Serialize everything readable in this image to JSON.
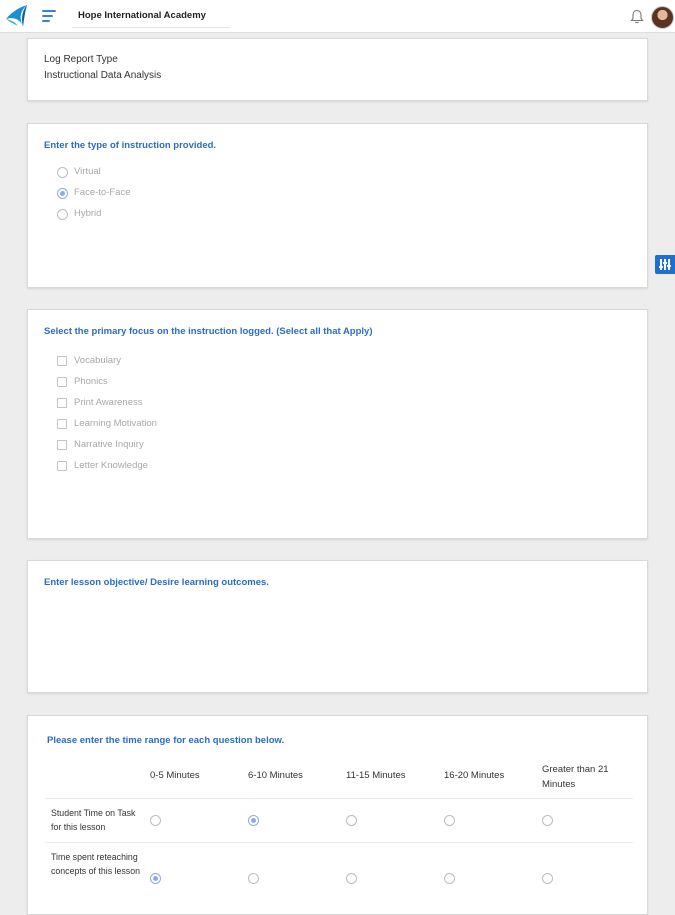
{
  "header": {
    "app_title": "Hope International Academy",
    "icons": [
      "logo-icon",
      "menu-icon",
      "bell-icon",
      "avatar"
    ]
  },
  "report_type": {
    "label": "Log Report Type",
    "value": "Instructional Data Analysis"
  },
  "instruction_type": {
    "question": "Enter the type of instruction provided.",
    "options": [
      "Virtual",
      "Face-to-Face",
      "Hybrid"
    ],
    "selected": "Face-to-Face"
  },
  "focus": {
    "question": "Select the primary focus on the instruction logged. (Select all that Apply)",
    "options": [
      "Vocabulary",
      "Phonics",
      "Print Awareness",
      "Learning Motivation",
      "Narrative Inquiry",
      "Letter Knowledge"
    ],
    "checked": []
  },
  "objective": {
    "question": "Enter lesson objective/ Desire learning outcomes.",
    "value": ""
  },
  "time_range": {
    "question": "Please enter the time range for each question below.",
    "columns": [
      "0-5 Minutes",
      "6-10 Minutes",
      "11-15 Minutes",
      "16-20 Minutes",
      "Greater than 21 Minutes"
    ],
    "rows": [
      {
        "label": "Student Time on Task for this lesson",
        "selected": "6-10 Minutes"
      },
      {
        "label": "Time spent reteaching concepts of this lesson",
        "selected": "0-5 Minutes"
      }
    ]
  },
  "colors": {
    "accent": "#2a6cc7",
    "radio_selected": "#8fa9ec",
    "side_tab": "#1f6fd0"
  }
}
